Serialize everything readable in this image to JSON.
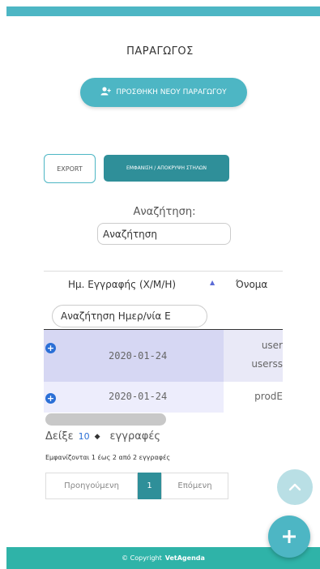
{
  "header": {
    "title": "ΠΑΡΑΓΩΓΟΣ"
  },
  "actions": {
    "add_producer_label": "ΠΡΟΣΘΗΚΗ ΝΕΟΥ ΠΑΡΑΓΩΓΟΥ",
    "add_producer_icon": "user-plus-icon",
    "export_label": "EXPORT",
    "toggle_columns_label": "ΕΜΦΑΝΙΣΗ / ΑΠΟΚΡΥΨΗ ΣΤΗΛΩΝ"
  },
  "search": {
    "label": "Αναζήτηση:",
    "value": "Αναζήτηση"
  },
  "table": {
    "columns": [
      "Ημ. Εγγραφής (Χ/Μ/Η)",
      "Όνομα"
    ],
    "sort_icon": "▲",
    "date_filter_value": "Αναζήτηση Ημερ/νία Ε",
    "rows": [
      {
        "date": "2020-01-24",
        "name_line1": "user",
        "name_line2": "userss"
      },
      {
        "date": "2020-01-24",
        "name_line1": "prodE",
        "name_line2": ""
      }
    ]
  },
  "length_menu": {
    "prefix": "Δείξε",
    "value": "10",
    "suffix": "εγγραφές"
  },
  "info_text": "Εμφανίζονται 1 έως 2 από 2 εγγραφές",
  "pagination": {
    "previous": "Προηγούμενη",
    "current": "1",
    "next": "Επόμενη"
  },
  "footer": {
    "copyright": "© Copyright",
    "brand": "VetAgenda"
  },
  "colors": {
    "accent": "#4db6c4",
    "dark_accent": "#2f8f99",
    "footer": "#2fb3a8"
  }
}
